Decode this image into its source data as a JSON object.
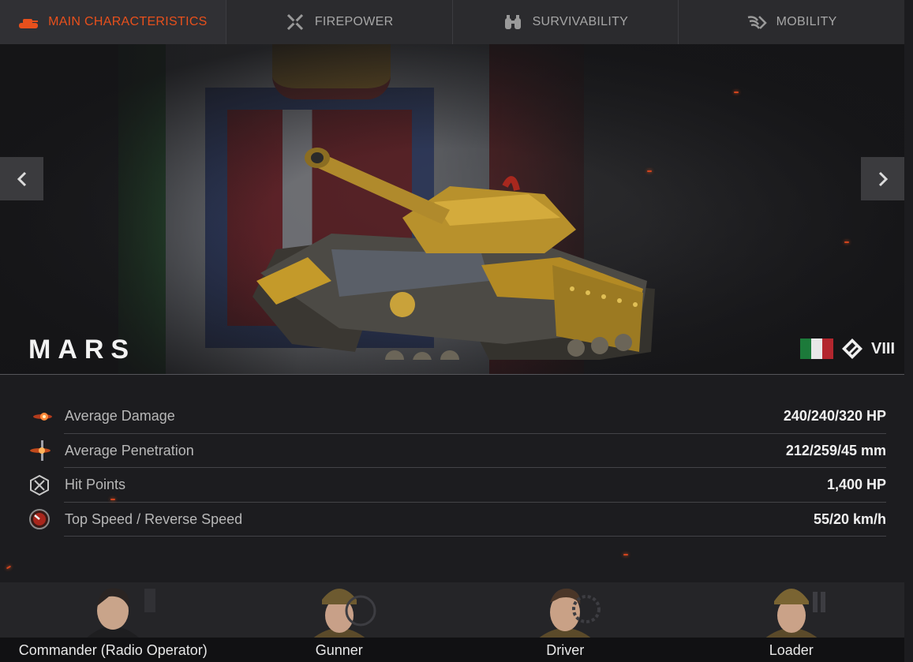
{
  "tabs": [
    {
      "label": "Main Characteristics",
      "active": true,
      "icon": "tank-icon"
    },
    {
      "label": "Firepower",
      "active": false,
      "icon": "crossed-guns-icon"
    },
    {
      "label": "Survivability",
      "active": false,
      "icon": "binoculars-icon"
    },
    {
      "label": "Mobility",
      "active": false,
      "icon": "wings-icon"
    }
  ],
  "vehicle": {
    "name": "MARS",
    "nation_flag": "italy-flag",
    "class_icon": "heavy-tank-icon",
    "tier": "VIII"
  },
  "stats": [
    {
      "label": "Average Damage",
      "value": "240/240/320 HP",
      "icon": "damage-icon"
    },
    {
      "label": "Average Penetration",
      "value": "212/259/45 mm",
      "icon": "penetration-icon"
    },
    {
      "label": "Hit Points",
      "value": "1,400 HP",
      "icon": "hit-points-icon"
    },
    {
      "label": "Top Speed / Reverse Speed",
      "value": "55/20 km/h",
      "icon": "speedometer-icon"
    }
  ],
  "crew": [
    {
      "role": "Commander (Radio Operator)",
      "icon": "commander-portrait"
    },
    {
      "role": "Gunner",
      "icon": "gunner-portrait"
    },
    {
      "role": "Driver",
      "icon": "driver-portrait"
    },
    {
      "role": "Loader",
      "icon": "loader-portrait"
    }
  ],
  "colors": {
    "accent": "#e8501c",
    "background": "#1c1c1f",
    "tab_bar": "#2b2b2e"
  }
}
